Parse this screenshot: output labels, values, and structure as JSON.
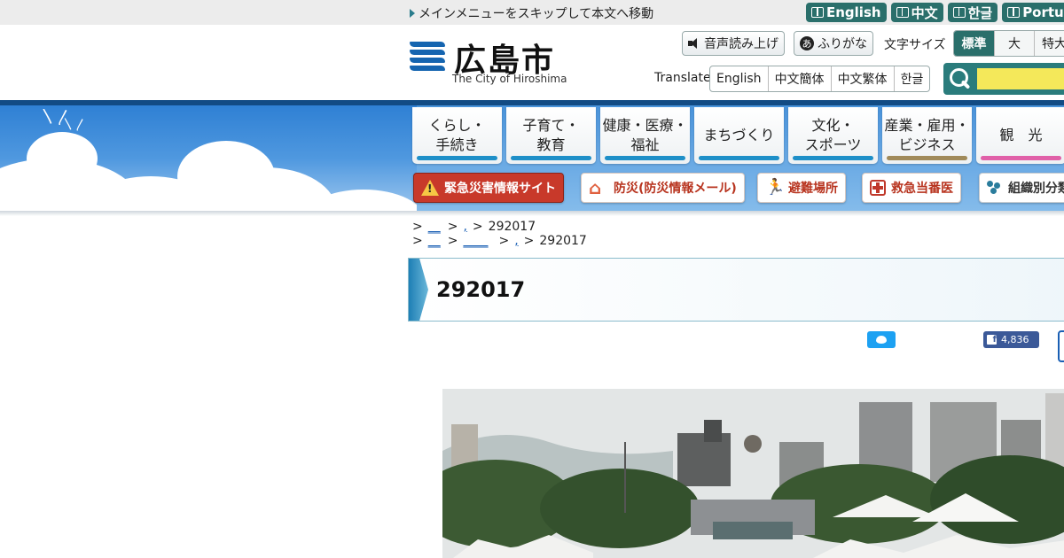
{
  "topbar": {
    "skip_link": "メインメニューをスキップして本文へ移動",
    "languages": [
      "English",
      "中文",
      "한글",
      "Portug"
    ]
  },
  "header": {
    "logo_jp": "広島市",
    "logo_en": "The City of Hiroshima",
    "voice_button": "音声読み上げ",
    "furigana_button": "ふりがな",
    "text_size_label": "文字サイズ",
    "text_sizes": [
      "標準",
      "大",
      "特大"
    ],
    "translate_label": "Translate",
    "translate_options": [
      "English",
      "中文簡体",
      "中文繁体",
      "한글"
    ],
    "search_placeholder": ""
  },
  "nav": {
    "items": [
      {
        "label": "くらし・\n手続き",
        "color": "#1e8fc8"
      },
      {
        "label": "子育て・\n教育",
        "color": "#1e8fc8"
      },
      {
        "label": "健康・医療・\n福祉",
        "color": "#1e8fc8"
      },
      {
        "label": "まちづくり",
        "color": "#1e8fc8"
      },
      {
        "label": "文化・\nスポーツ",
        "color": "#1e8fc8"
      },
      {
        "label": "産業・雇用・\nビジネス",
        "color": "#a08a5a"
      },
      {
        "label": "観　光",
        "color": "#e060a8"
      }
    ]
  },
  "quick_links": {
    "emergency": "緊急災害情報サイト",
    "disaster": "防災(防災情報メール)",
    "shelter": "避難場所",
    "emergency_doctor": "救急当番医",
    "org": "組織別分類"
  },
  "breadcrumbs": {
    "row1": {
      "prefix": ">",
      "link1": "__",
      "sep1": ">",
      "link2": ",",
      "sep2": ">",
      "current": "292017"
    },
    "row2": {
      "prefix": ">",
      "link1": "__",
      "sep1": ">",
      "link2": "____",
      "sep2": ">",
      "link3": ",",
      "sep3": ">",
      "current": "292017"
    }
  },
  "page": {
    "title": "292017",
    "facebook_count": "4,836"
  },
  "colors": {
    "header_navy": "#124b84",
    "accent_teal": "#2a6f6b",
    "emergency_red": "#c8392a",
    "search_yellow": "#f4e85a"
  }
}
